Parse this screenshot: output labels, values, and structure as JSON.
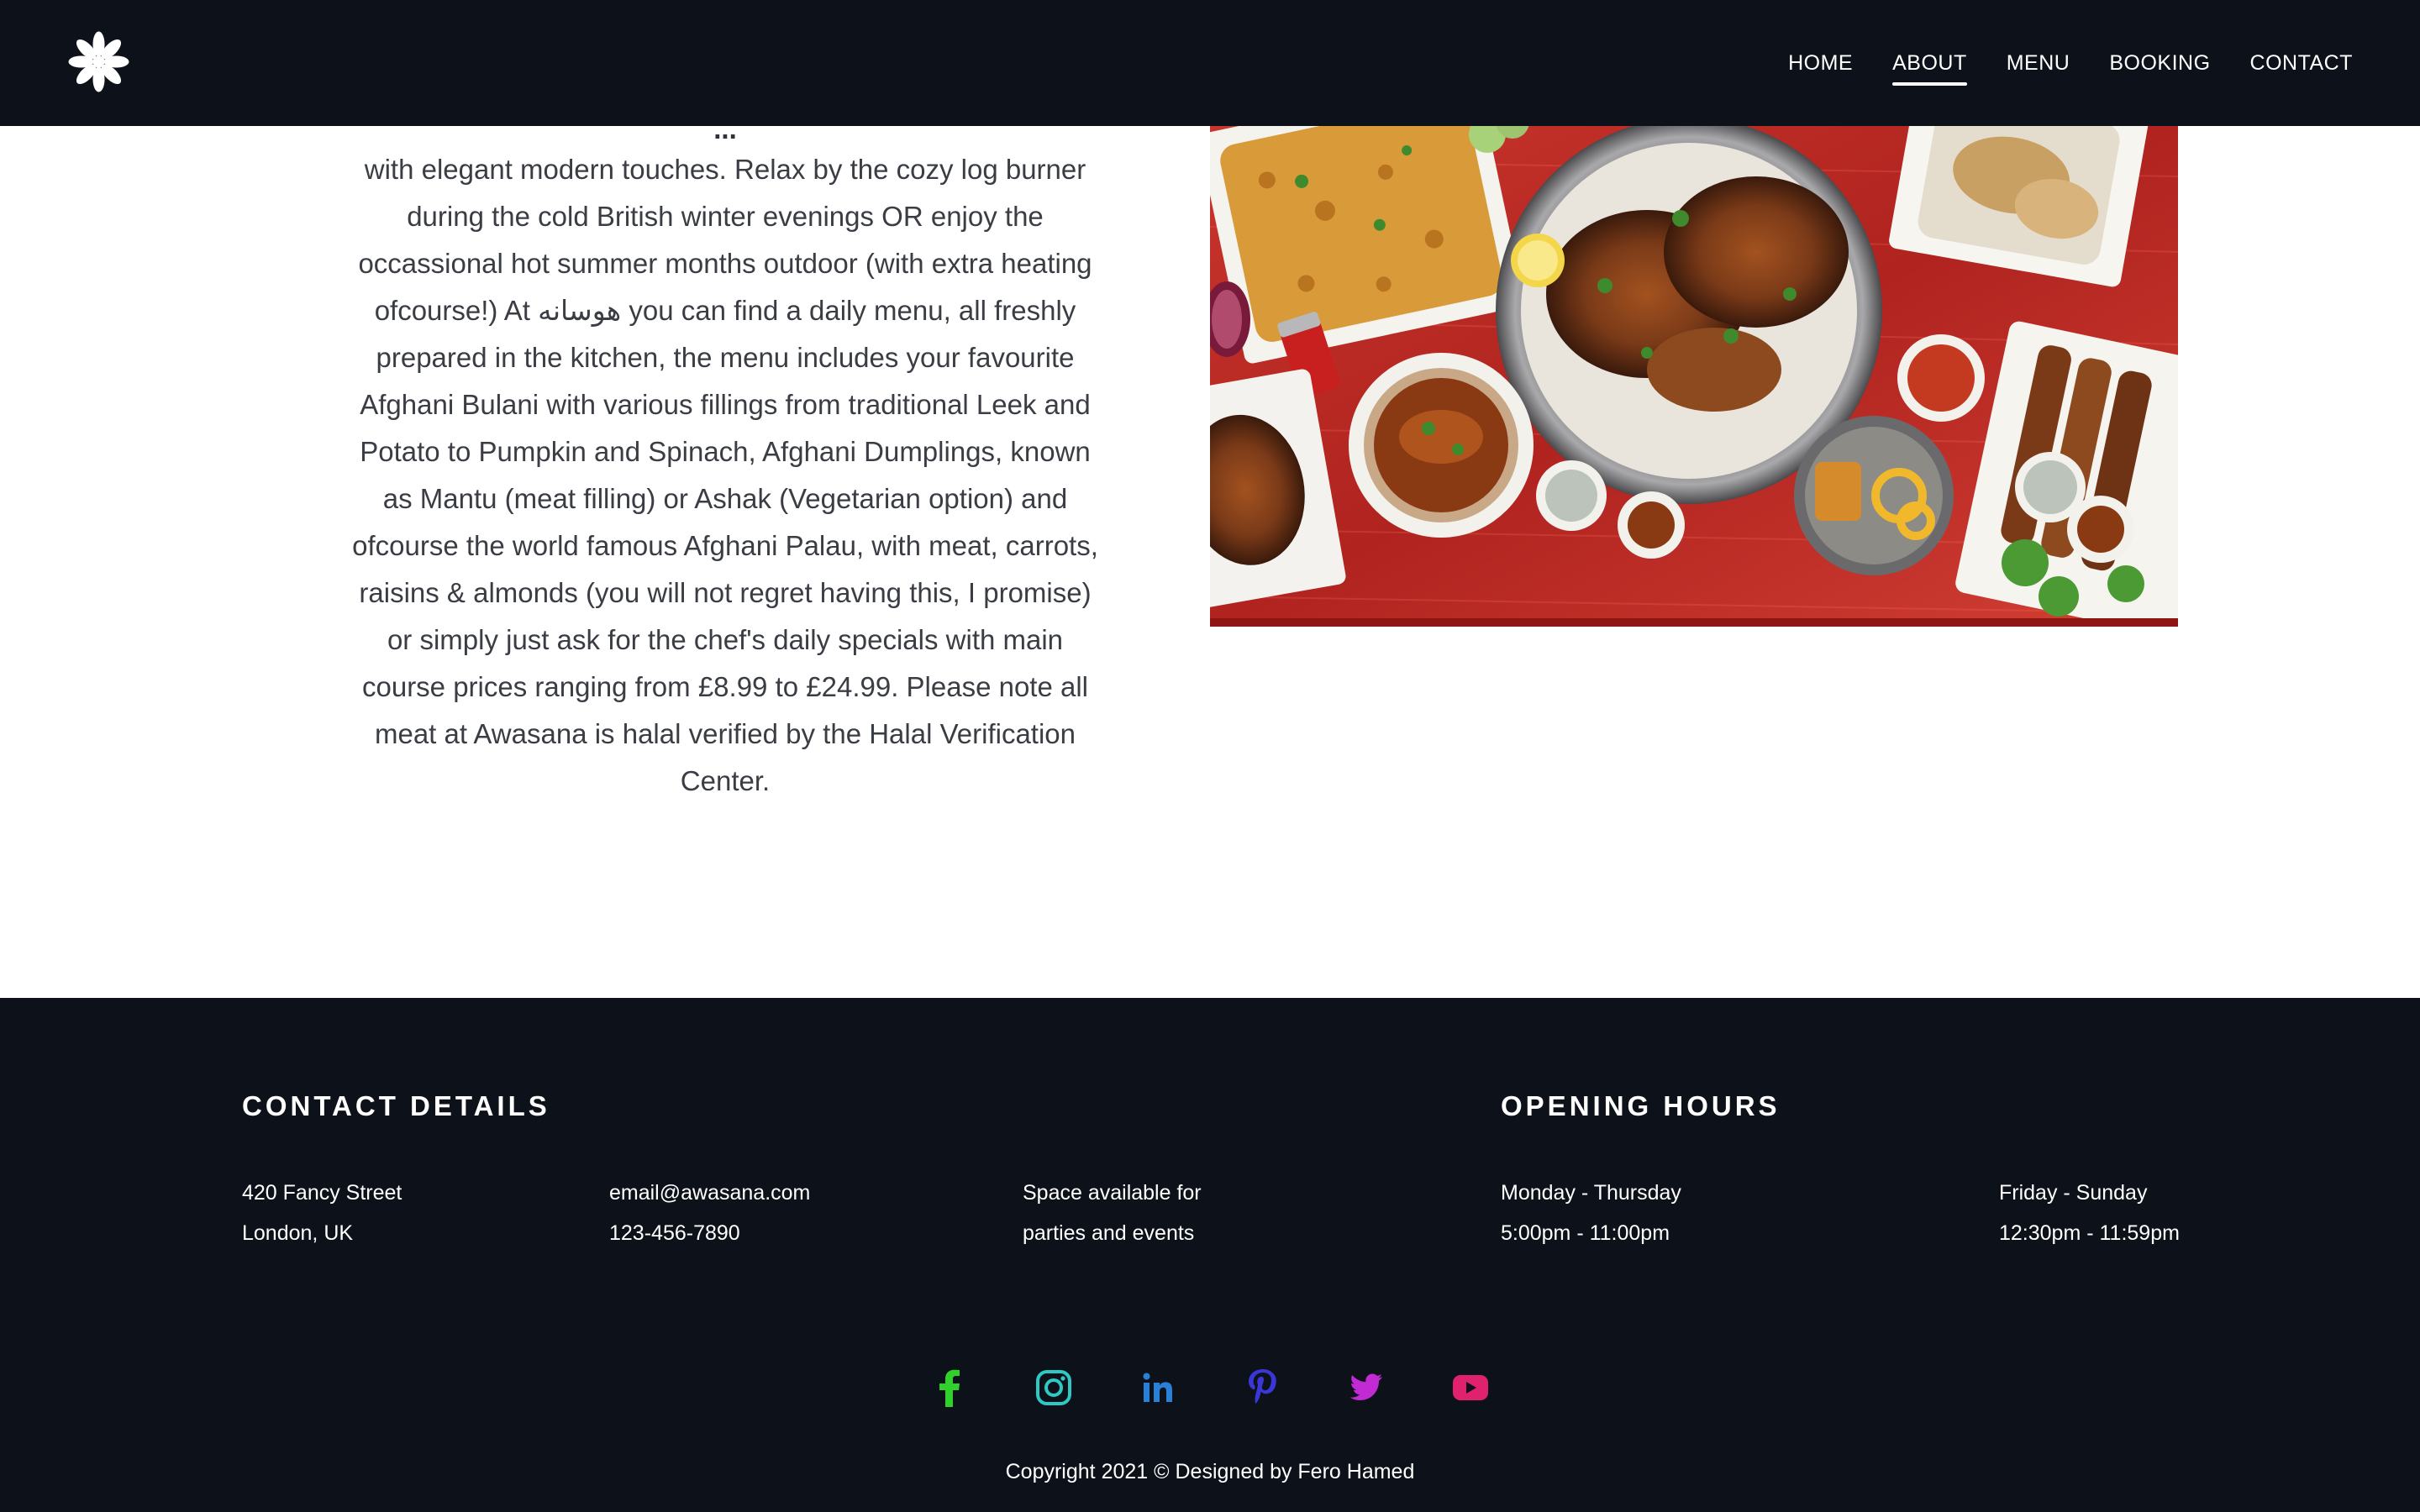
{
  "nav": {
    "logo_icon": "asterisk-flower-logo",
    "links": [
      {
        "label": "HOME",
        "active": false
      },
      {
        "label": "ABOUT",
        "active": true
      },
      {
        "label": "MENU",
        "active": false
      },
      {
        "label": "BOOKING",
        "active": false
      },
      {
        "label": "CONTACT",
        "active": false
      }
    ]
  },
  "about": {
    "partial_top_line": "...",
    "lines": [
      "with elegant modern touches. Relax by the cozy log burner",
      "during the cold British winter evenings OR enjoy the",
      "occassional hot summer months outdoor (with extra heating",
      "ofcourse!) At هوسانه you can find a daily menu, all freshly",
      "prepared in the kitchen, the menu includes your favourite",
      "Afghani Bulani with various fillings from traditional Leek and",
      "Potato to Pumpkin and Spinach, Afghani Dumplings, known",
      "as Mantu (meat filling) or Ashak (Vegetarian option) and",
      "ofcourse the world famous Afghani Palau, with meat, carrots,",
      "raisins & almonds (you will not regret having this, I promise)",
      "or simply just ask for the chef's daily specials with main",
      "course prices ranging from £8.99 to £24.99. Please note all",
      "meat at Awasana is halal verified by the Halal Verification",
      "Center."
    ],
    "image_subject": "Afghan food spread on red table"
  },
  "footer": {
    "contact_heading": "CONTACT DETAILS",
    "hours_heading": "OPENING HOURS",
    "address": [
      "420 Fancy Street",
      "London, UK"
    ],
    "contact": [
      "email@awasana.com",
      "123-456-7890"
    ],
    "space": [
      "Space available for",
      "parties and events"
    ],
    "weekday": [
      "Monday - Thursday",
      "5:00pm - 11:00pm"
    ],
    "weekend": [
      "Friday - Sunday",
      "12:30pm - 11:59pm"
    ],
    "social": [
      {
        "name": "facebook-icon",
        "color": "#2fd12a"
      },
      {
        "name": "instagram-icon",
        "color": "#2ec9c4"
      },
      {
        "name": "linkedin-icon",
        "color": "#2a7fd6"
      },
      {
        "name": "pinterest-icon",
        "color": "#3b36d8"
      },
      {
        "name": "twitter-icon",
        "color": "#c22ad3"
      },
      {
        "name": "youtube-icon",
        "color": "#e0226e"
      }
    ],
    "copyright": "Copyright 2021 © Designed by Fero Hamed"
  }
}
